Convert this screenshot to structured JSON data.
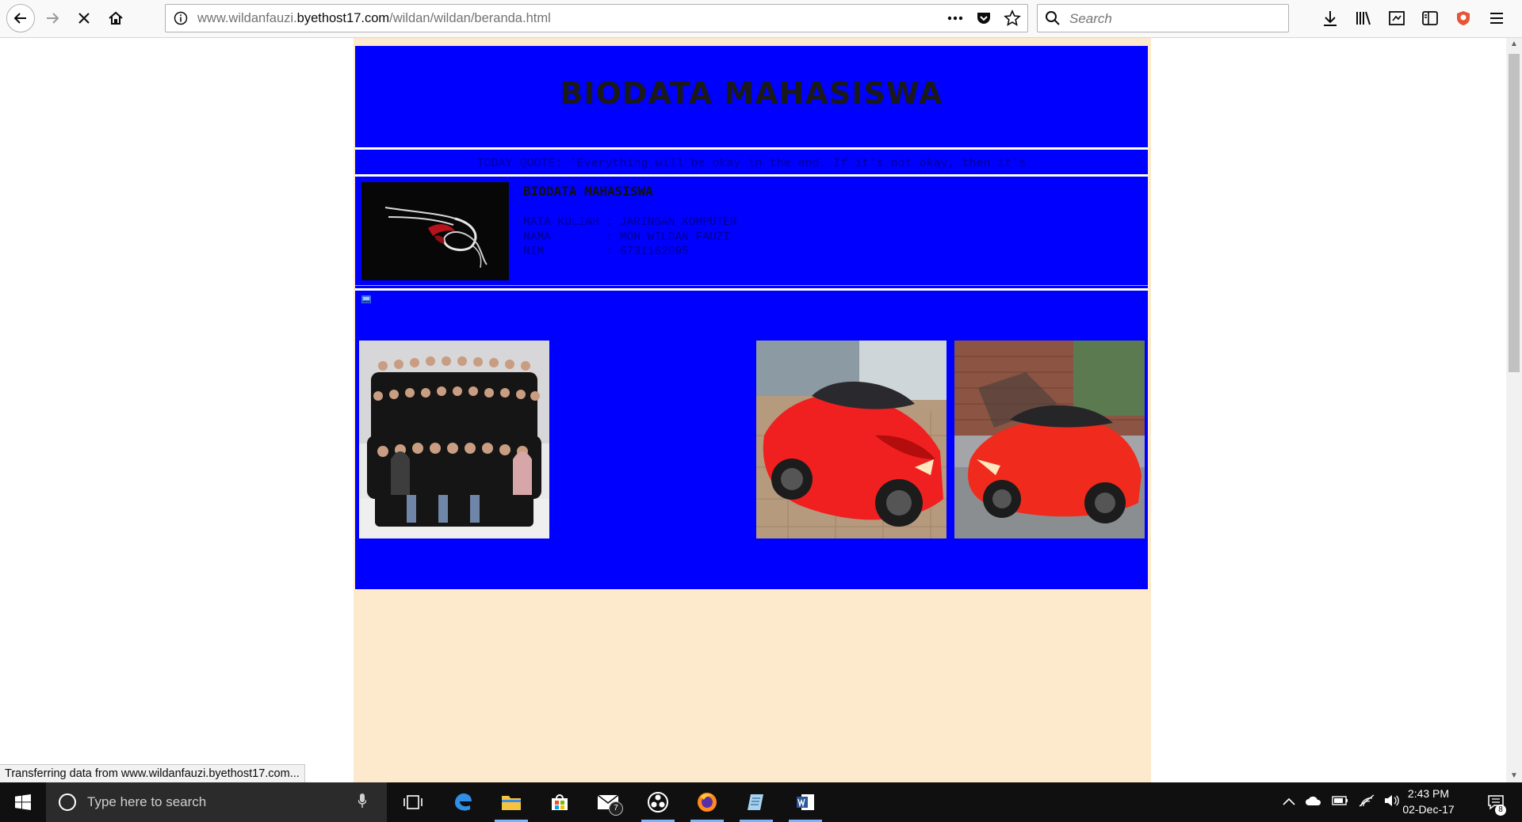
{
  "browser": {
    "url_prefix": "www.wildanfauzi.",
    "url_domain": "byethost17.com",
    "url_path": "/wildan/wildan/beranda.html",
    "search_placeholder": "Search",
    "status_text": "Transferring data from www.wildanfauzi.byethost17.com..."
  },
  "page": {
    "title": "BIODATA MAHASISWA",
    "quote": "TODAY QUOTE: 'Everything will be okay in the end. If it's not okay, then it's",
    "bio_heading": "BIODATA MAHASISWA",
    "bio_rows": [
      {
        "label": "MATA KULIAH",
        "value": "JARINGAN KOMPUTER"
      },
      {
        "label": "NAMA",
        "value": "MOH WILDAN FAUZI"
      },
      {
        "label": "NIM",
        "value": "6731162095"
      }
    ],
    "colors": {
      "content_bg": "#0000ff",
      "page_bg": "#fde9cc"
    }
  },
  "taskbar": {
    "search_placeholder": "Type here to search",
    "mail_badge": "7",
    "time": "2:43 PM",
    "date": "02-Dec-17",
    "notification_count": "8"
  }
}
